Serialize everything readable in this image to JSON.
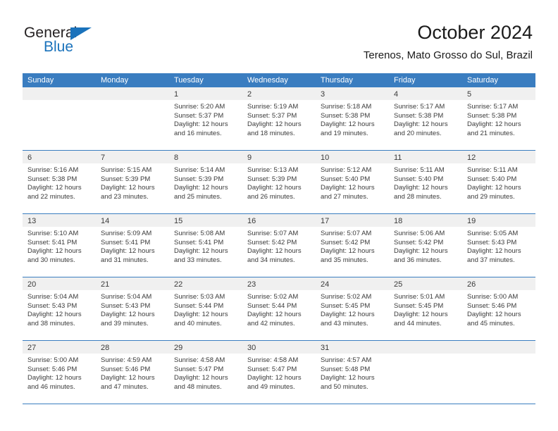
{
  "brand": {
    "name_top": "General",
    "name_bottom": "Blue",
    "triangle_color": "#1a72bb"
  },
  "header": {
    "title": "October 2024",
    "subtitle": "Terenos, Mato Grosso do Sul, Brazil"
  },
  "theme": {
    "header_blue": "#3a7dc0",
    "date_band_gray": "#f0f0f0",
    "text_color": "#3a3a3a"
  },
  "calendar": {
    "weekday_headers": [
      "Sunday",
      "Monday",
      "Tuesday",
      "Wednesday",
      "Thursday",
      "Friday",
      "Saturday"
    ],
    "weeks": [
      [
        {
          "day": "",
          "lines": []
        },
        {
          "day": "",
          "lines": []
        },
        {
          "day": "1",
          "lines": [
            "Sunrise: 5:20 AM",
            "Sunset: 5:37 PM",
            "Daylight: 12 hours",
            "and 16 minutes."
          ]
        },
        {
          "day": "2",
          "lines": [
            "Sunrise: 5:19 AM",
            "Sunset: 5:37 PM",
            "Daylight: 12 hours",
            "and 18 minutes."
          ]
        },
        {
          "day": "3",
          "lines": [
            "Sunrise: 5:18 AM",
            "Sunset: 5:38 PM",
            "Daylight: 12 hours",
            "and 19 minutes."
          ]
        },
        {
          "day": "4",
          "lines": [
            "Sunrise: 5:17 AM",
            "Sunset: 5:38 PM",
            "Daylight: 12 hours",
            "and 20 minutes."
          ]
        },
        {
          "day": "5",
          "lines": [
            "Sunrise: 5:17 AM",
            "Sunset: 5:38 PM",
            "Daylight: 12 hours",
            "and 21 minutes."
          ]
        }
      ],
      [
        {
          "day": "6",
          "lines": [
            "Sunrise: 5:16 AM",
            "Sunset: 5:38 PM",
            "Daylight: 12 hours",
            "and 22 minutes."
          ]
        },
        {
          "day": "7",
          "lines": [
            "Sunrise: 5:15 AM",
            "Sunset: 5:39 PM",
            "Daylight: 12 hours",
            "and 23 minutes."
          ]
        },
        {
          "day": "8",
          "lines": [
            "Sunrise: 5:14 AM",
            "Sunset: 5:39 PM",
            "Daylight: 12 hours",
            "and 25 minutes."
          ]
        },
        {
          "day": "9",
          "lines": [
            "Sunrise: 5:13 AM",
            "Sunset: 5:39 PM",
            "Daylight: 12 hours",
            "and 26 minutes."
          ]
        },
        {
          "day": "10",
          "lines": [
            "Sunrise: 5:12 AM",
            "Sunset: 5:40 PM",
            "Daylight: 12 hours",
            "and 27 minutes."
          ]
        },
        {
          "day": "11",
          "lines": [
            "Sunrise: 5:11 AM",
            "Sunset: 5:40 PM",
            "Daylight: 12 hours",
            "and 28 minutes."
          ]
        },
        {
          "day": "12",
          "lines": [
            "Sunrise: 5:11 AM",
            "Sunset: 5:40 PM",
            "Daylight: 12 hours",
            "and 29 minutes."
          ]
        }
      ],
      [
        {
          "day": "13",
          "lines": [
            "Sunrise: 5:10 AM",
            "Sunset: 5:41 PM",
            "Daylight: 12 hours",
            "and 30 minutes."
          ]
        },
        {
          "day": "14",
          "lines": [
            "Sunrise: 5:09 AM",
            "Sunset: 5:41 PM",
            "Daylight: 12 hours",
            "and 31 minutes."
          ]
        },
        {
          "day": "15",
          "lines": [
            "Sunrise: 5:08 AM",
            "Sunset: 5:41 PM",
            "Daylight: 12 hours",
            "and 33 minutes."
          ]
        },
        {
          "day": "16",
          "lines": [
            "Sunrise: 5:07 AM",
            "Sunset: 5:42 PM",
            "Daylight: 12 hours",
            "and 34 minutes."
          ]
        },
        {
          "day": "17",
          "lines": [
            "Sunrise: 5:07 AM",
            "Sunset: 5:42 PM",
            "Daylight: 12 hours",
            "and 35 minutes."
          ]
        },
        {
          "day": "18",
          "lines": [
            "Sunrise: 5:06 AM",
            "Sunset: 5:42 PM",
            "Daylight: 12 hours",
            "and 36 minutes."
          ]
        },
        {
          "day": "19",
          "lines": [
            "Sunrise: 5:05 AM",
            "Sunset: 5:43 PM",
            "Daylight: 12 hours",
            "and 37 minutes."
          ]
        }
      ],
      [
        {
          "day": "20",
          "lines": [
            "Sunrise: 5:04 AM",
            "Sunset: 5:43 PM",
            "Daylight: 12 hours",
            "and 38 minutes."
          ]
        },
        {
          "day": "21",
          "lines": [
            "Sunrise: 5:04 AM",
            "Sunset: 5:43 PM",
            "Daylight: 12 hours",
            "and 39 minutes."
          ]
        },
        {
          "day": "22",
          "lines": [
            "Sunrise: 5:03 AM",
            "Sunset: 5:44 PM",
            "Daylight: 12 hours",
            "and 40 minutes."
          ]
        },
        {
          "day": "23",
          "lines": [
            "Sunrise: 5:02 AM",
            "Sunset: 5:44 PM",
            "Daylight: 12 hours",
            "and 42 minutes."
          ]
        },
        {
          "day": "24",
          "lines": [
            "Sunrise: 5:02 AM",
            "Sunset: 5:45 PM",
            "Daylight: 12 hours",
            "and 43 minutes."
          ]
        },
        {
          "day": "25",
          "lines": [
            "Sunrise: 5:01 AM",
            "Sunset: 5:45 PM",
            "Daylight: 12 hours",
            "and 44 minutes."
          ]
        },
        {
          "day": "26",
          "lines": [
            "Sunrise: 5:00 AM",
            "Sunset: 5:46 PM",
            "Daylight: 12 hours",
            "and 45 minutes."
          ]
        }
      ],
      [
        {
          "day": "27",
          "lines": [
            "Sunrise: 5:00 AM",
            "Sunset: 5:46 PM",
            "Daylight: 12 hours",
            "and 46 minutes."
          ]
        },
        {
          "day": "28",
          "lines": [
            "Sunrise: 4:59 AM",
            "Sunset: 5:46 PM",
            "Daylight: 12 hours",
            "and 47 minutes."
          ]
        },
        {
          "day": "29",
          "lines": [
            "Sunrise: 4:58 AM",
            "Sunset: 5:47 PM",
            "Daylight: 12 hours",
            "and 48 minutes."
          ]
        },
        {
          "day": "30",
          "lines": [
            "Sunrise: 4:58 AM",
            "Sunset: 5:47 PM",
            "Daylight: 12 hours",
            "and 49 minutes."
          ]
        },
        {
          "day": "31",
          "lines": [
            "Sunrise: 4:57 AM",
            "Sunset: 5:48 PM",
            "Daylight: 12 hours",
            "and 50 minutes."
          ]
        },
        {
          "day": "",
          "lines": []
        },
        {
          "day": "",
          "lines": []
        }
      ]
    ]
  }
}
